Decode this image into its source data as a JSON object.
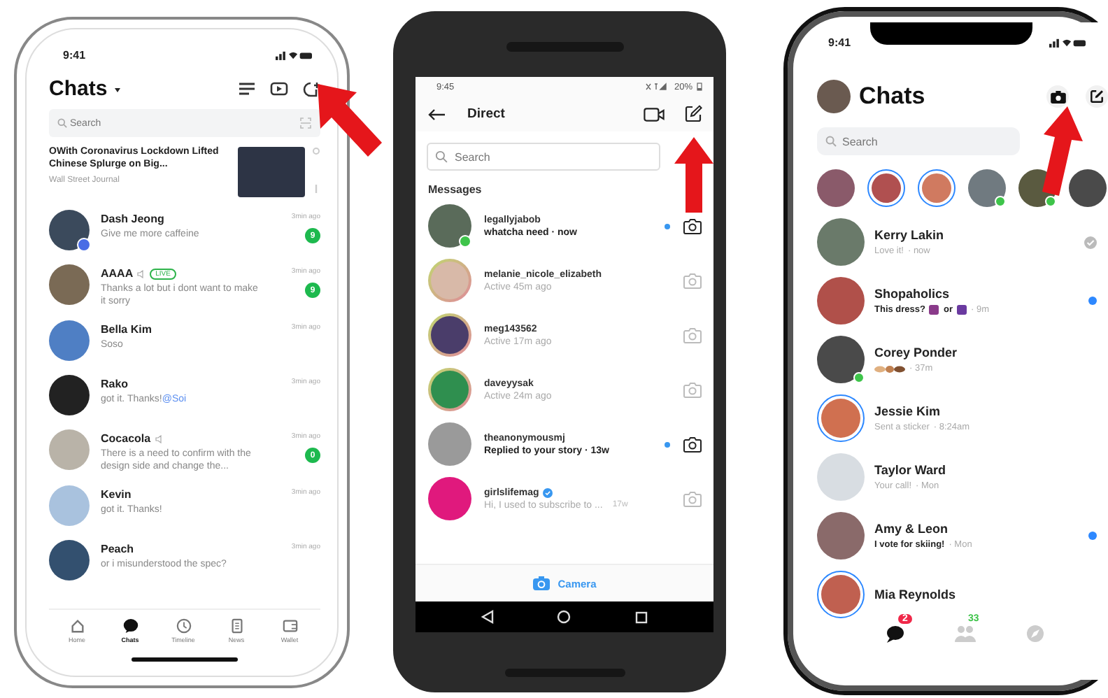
{
  "left_phone": {
    "time": "9:41",
    "title": "Chats",
    "search": {
      "placeholder": "Search"
    },
    "news": {
      "headline": "OWith Coronavirus Lockdown Lifted Chinese Splurge on Big...",
      "source": "Wall Street Journal"
    },
    "chats": [
      {
        "name": "Dash Jeong",
        "message": "Give me more caffeine",
        "time": "3min ago",
        "unread": "9",
        "verified": true,
        "muted": false
      },
      {
        "name": "AAAA",
        "tag": "LIVE",
        "message": "Thanks a lot but i dont want to make it sorry",
        "time": "3min ago",
        "unread": "9",
        "verified": false,
        "muted": true
      },
      {
        "name": "Bella Kim",
        "message": "Soso",
        "time": "3min ago",
        "verified": false,
        "muted": false
      },
      {
        "name": "Rako",
        "message": "got it. Thanks!",
        "mention": "@Soi",
        "time": "3min ago",
        "verified": false,
        "muted": false
      },
      {
        "name": "Cocacola",
        "message": "There is a need to confirm with the design side and change the...",
        "time": "3min ago",
        "unread": "0",
        "verified": false,
        "muted": true
      },
      {
        "name": "Kevin",
        "message": "got it. Thanks!",
        "time": "3min ago",
        "verified": false,
        "muted": false
      },
      {
        "name": "Peach",
        "message": "or i misunderstood the spec?",
        "time": "3min ago",
        "verified": false,
        "muted": false
      }
    ],
    "tabs": [
      {
        "label": "Home",
        "kind": "home",
        "selected": false
      },
      {
        "label": "Chats",
        "kind": "chats",
        "selected": true
      },
      {
        "label": "Timeline",
        "kind": "timeline",
        "selected": false
      },
      {
        "label": "News",
        "kind": "news",
        "selected": false
      },
      {
        "label": "Wallet",
        "kind": "wallet",
        "selected": false
      }
    ]
  },
  "middle_phone": {
    "time": "9:45",
    "battery": "20%",
    "title": "Direct",
    "search": {
      "placeholder": "Search"
    },
    "section": "Messages",
    "threads": [
      {
        "username": "legallyjabob",
        "status": "whatcha need · now",
        "unread": true,
        "online": true,
        "story": false,
        "verified": false
      },
      {
        "username": "melanie_nicole_elizabeth",
        "status": "Active 45m ago",
        "unread": false,
        "online": false,
        "story": true,
        "verified": false
      },
      {
        "username": "meg143562",
        "status": "Active 17m ago",
        "unread": false,
        "online": false,
        "story": true,
        "verified": false
      },
      {
        "username": "daveyysak",
        "status": "Active 24m ago",
        "unread": false,
        "online": false,
        "story": true,
        "verified": false
      },
      {
        "username": "theanonymousmj",
        "status": "Replied to your story · 13w",
        "unread": true,
        "online": false,
        "story": false,
        "verified": false
      },
      {
        "username": "girlslifemag",
        "status": "Hi, I used to subscribe to ...",
        "time": "17w",
        "unread": false,
        "online": false,
        "story": false,
        "verified": true
      }
    ],
    "camera_button": "Camera"
  },
  "right_phone": {
    "time": "9:41",
    "title": "Chats",
    "search": {
      "placeholder": "Search"
    },
    "stories": [
      {
        "story": false,
        "online": false
      },
      {
        "story": true,
        "online": false
      },
      {
        "story": true,
        "online": false
      },
      {
        "story": false,
        "online": true
      },
      {
        "story": false,
        "online": true
      },
      {
        "story": false,
        "online": false
      }
    ],
    "chats": [
      {
        "name": "Kerry Lakin",
        "message": "Love it!",
        "time": "· now",
        "unread": false,
        "seen": true,
        "story": false,
        "online": false
      },
      {
        "name": "Shopaholics",
        "message": "This dress?",
        "choice": "or",
        "time": "· 9m",
        "unread": true,
        "seen": false,
        "story": false,
        "online": false
      },
      {
        "name": "Corey Ponder",
        "sticker": true,
        "time": "· 37m",
        "unread": false,
        "seen": false,
        "story": false,
        "online": true
      },
      {
        "name": "Jessie Kim",
        "message": "Sent a sticker",
        "time": "· 8:24am",
        "unread": false,
        "seen": false,
        "story": true,
        "online": false
      },
      {
        "name": "Taylor Ward",
        "message": "Your call!",
        "time": "· Mon",
        "unread": false,
        "seen": false,
        "story": false,
        "online": false
      },
      {
        "name": "Amy & Leon",
        "message": "I vote for skiing!",
        "time": "· Mon",
        "unread": true,
        "seen": false,
        "story": false,
        "online": false
      },
      {
        "name": "Mia Reynolds",
        "unread": false,
        "seen": false,
        "story": true,
        "online": false
      }
    ],
    "tabs": [
      {
        "kind": "chats",
        "badge": "2",
        "selected": true
      },
      {
        "kind": "people",
        "badge": "33",
        "selected": false
      },
      {
        "kind": "discover",
        "selected": false
      }
    ]
  }
}
